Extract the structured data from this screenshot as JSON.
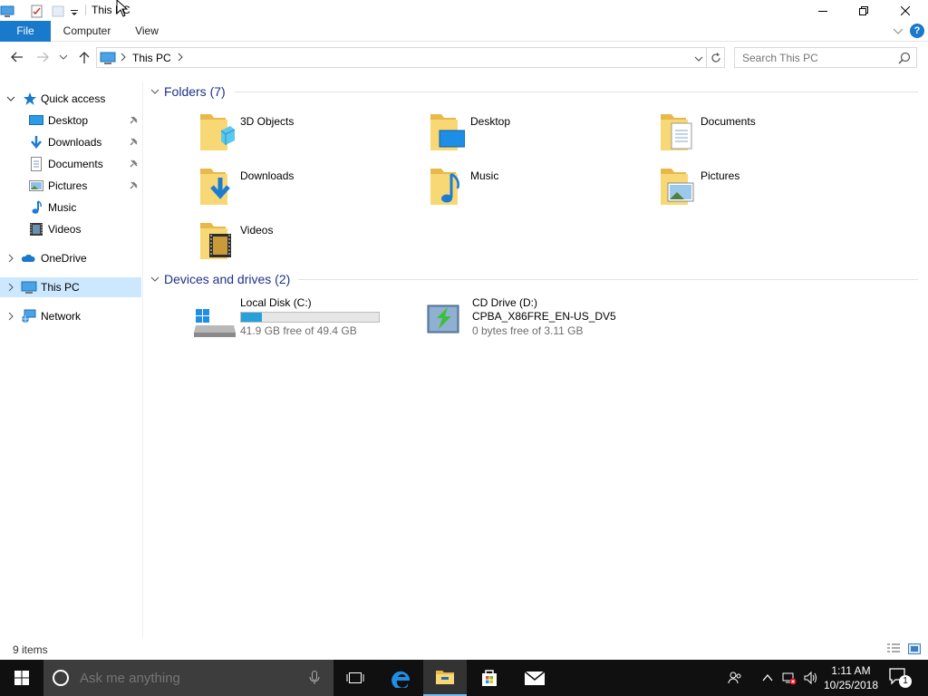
{
  "window": {
    "title": "This PC"
  },
  "ribbon": {
    "file": "File",
    "computer": "Computer",
    "view": "View"
  },
  "address": {
    "path": "This PC",
    "search_placeholder": "Search This PC"
  },
  "nav": {
    "quick_access": "Quick access",
    "items": [
      {
        "label": "Desktop",
        "icon": "desktop-icon",
        "pinned": true
      },
      {
        "label": "Downloads",
        "icon": "downloads-icon",
        "pinned": true
      },
      {
        "label": "Documents",
        "icon": "documents-icon",
        "pinned": true
      },
      {
        "label": "Pictures",
        "icon": "pictures-icon",
        "pinned": true
      },
      {
        "label": "Music",
        "icon": "music-icon",
        "pinned": false
      },
      {
        "label": "Videos",
        "icon": "videos-icon",
        "pinned": false
      }
    ],
    "onedrive": "OneDrive",
    "this_pc": "This PC",
    "network": "Network"
  },
  "folders": {
    "header": "Folders (7)",
    "items": [
      {
        "label": "3D Objects",
        "icon": "3d-objects-folder-icon"
      },
      {
        "label": "Desktop",
        "icon": "desktop-folder-icon"
      },
      {
        "label": "Documents",
        "icon": "documents-folder-icon"
      },
      {
        "label": "Downloads",
        "icon": "downloads-folder-icon"
      },
      {
        "label": "Music",
        "icon": "music-folder-icon"
      },
      {
        "label": "Pictures",
        "icon": "pictures-folder-icon"
      },
      {
        "label": "Videos",
        "icon": "videos-folder-icon"
      }
    ]
  },
  "drives": {
    "header": "Devices and drives (2)",
    "local": {
      "name": "Local Disk (C:)",
      "free": "41.9 GB free of 49.4 GB",
      "used_fraction": 0.15
    },
    "cd": {
      "name": "CD Drive (D:)",
      "label": "CPBA_X86FRE_EN-US_DV5",
      "free": "0 bytes free of 3.11 GB"
    }
  },
  "status": {
    "count": "9 items"
  },
  "taskbar": {
    "search_placeholder": "Ask me anything",
    "time": "1:11 AM",
    "date": "10/25/2018",
    "notifications": "1"
  },
  "colors": {
    "accent": "#1979ca",
    "selected": "#cce8ff",
    "group_header": "#1e3287",
    "folder": "#f8d775",
    "taskbar": "#101010"
  }
}
